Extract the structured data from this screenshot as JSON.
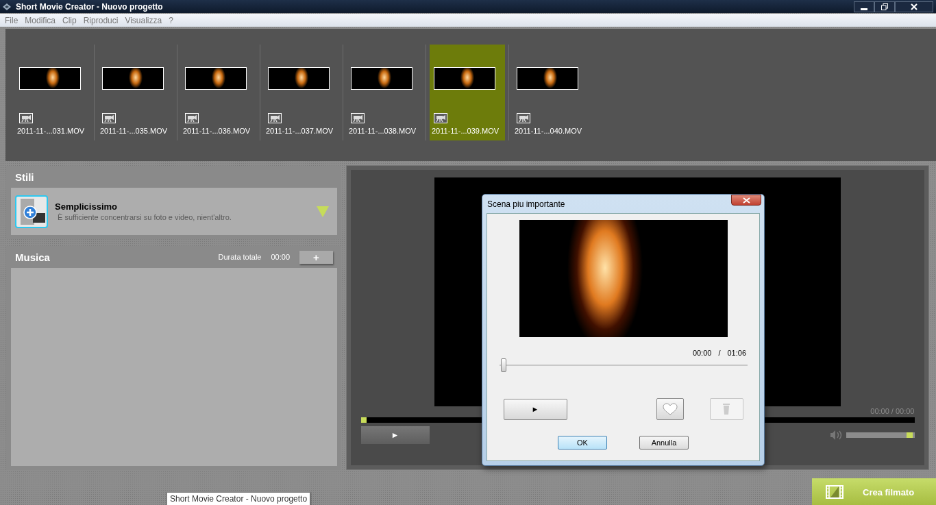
{
  "window": {
    "title": "Short Movie Creator - Nuovo progetto"
  },
  "menu": [
    "File",
    "Modifica",
    "Clip",
    "Riproduci",
    "Visualizza",
    "?"
  ],
  "clips": [
    {
      "name": "2011-11-...031.MOV",
      "selected": false
    },
    {
      "name": "2011-11-...035.MOV",
      "selected": false
    },
    {
      "name": "2011-11-...036.MOV",
      "selected": false
    },
    {
      "name": "2011-11-...037.MOV",
      "selected": false
    },
    {
      "name": "2011-11-...038.MOV",
      "selected": false
    },
    {
      "name": "2011-11-...039.MOV",
      "selected": true
    },
    {
      "name": "2011-11-...040.MOV",
      "selected": false
    }
  ],
  "styles": {
    "title": "Stili",
    "name": "Semplicissimo",
    "description": "È sufficiente concentrarsi su foto e video, nient'altro."
  },
  "music": {
    "title": "Musica",
    "duration_label": "Durata totale",
    "duration": "00:00",
    "add_button": "+"
  },
  "preview": {
    "time": "00:00 / 00:00",
    "progress": {
      "level": 0
    },
    "play_button": "►",
    "volume": {
      "level": 0.97
    }
  },
  "dialog": {
    "title": "Scena piu importante",
    "current_time": "00:00",
    "separator": "/",
    "total_time": "01:06",
    "seek": {
      "level": 0
    },
    "play_button": "►",
    "delete_disabled": true,
    "buttons": [
      {
        "label": "OK",
        "default": true
      },
      {
        "label": "Annulla",
        "default": false
      }
    ]
  },
  "create_button": "Crea filmato",
  "tooltip": "Short Movie Creator - Nuovo progetto"
}
